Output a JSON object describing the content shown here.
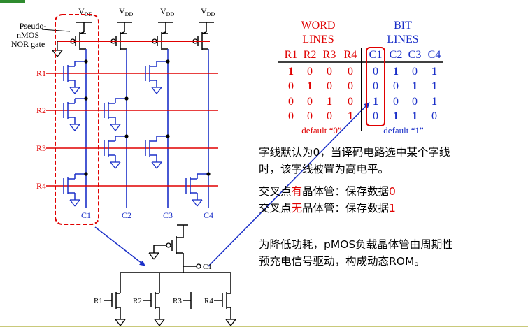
{
  "slide": {
    "bottom_rule_color": "#c9c97a",
    "title_bar_color": "#2e8b2e"
  },
  "circuit": {
    "label_pseudo": "Pseudo-",
    "label_nmos": "nMOS",
    "label_nor": "NOR gate",
    "vdd": "V",
    "vdd_sub": "DD",
    "rows": [
      "R1",
      "R2",
      "R3",
      "R4"
    ],
    "cols": [
      "C1",
      "C2",
      "C3",
      "C4"
    ],
    "row_color": "#e00000",
    "col_color": "#1a2fc8"
  },
  "table": {
    "word_lines_1": "WORD",
    "word_lines_2": "LINES",
    "bit_lines_1": "BIT",
    "bit_lines_2": "LINES",
    "row_headers": [
      "R1",
      "R2",
      "R3",
      "R4"
    ],
    "col_headers": [
      "C1",
      "C2",
      "C3",
      "C4"
    ],
    "word_bits": [
      [
        "1",
        "0",
        "0",
        "0"
      ],
      [
        "0",
        "1",
        "0",
        "0"
      ],
      [
        "0",
        "0",
        "1",
        "0"
      ],
      [
        "0",
        "0",
        "0",
        "1"
      ]
    ],
    "bit_values": [
      [
        "0",
        "1",
        "0",
        "1"
      ],
      [
        "0",
        "0",
        "1",
        "1"
      ],
      [
        "1",
        "0",
        "0",
        "1"
      ],
      [
        "0",
        "1",
        "1",
        "0"
      ]
    ],
    "default_word": "default “0”",
    "default_bit": "default “1”"
  },
  "notes": {
    "p1_line1": "字线默认为0，当译码电路选中某个字线",
    "p1_line2": "时，该字线被置为高电平。",
    "p2_prefix": "交叉点",
    "p2_key": "有",
    "p2_suffix": "晶体管：保存数据",
    "p2_value": "0",
    "p3_prefix": "交叉点",
    "p3_key": "无",
    "p3_suffix": "晶体管：保存数据",
    "p3_value": "1",
    "p4_line1": "为降低功耗，pMOS负载晶体管由周期性",
    "p4_line2": "预充电信号驱动，构成动态ROM。"
  },
  "detail": {
    "out_label": "C1",
    "inputs": [
      "R1",
      "R2",
      "R3",
      "R4"
    ]
  }
}
